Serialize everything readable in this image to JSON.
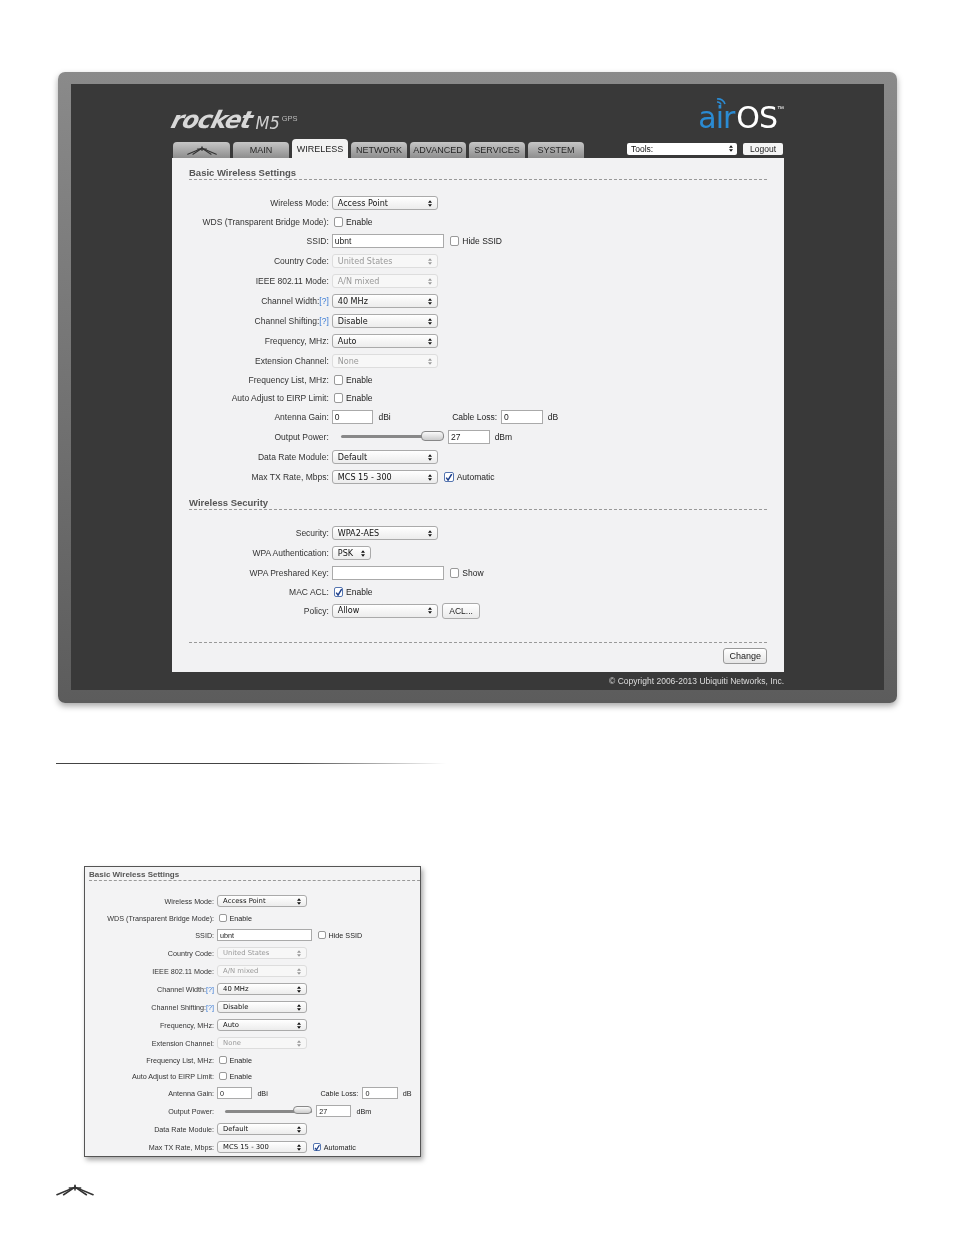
{
  "screenshot": {
    "brand": {
      "product": "rocket",
      "model": "M5",
      "suffix": "GPS",
      "os_prefix": "air",
      "os": "OS",
      "trademark": "™"
    },
    "tabs": [
      {
        "kind": "logo",
        "selected": false
      },
      {
        "kind": "text",
        "label": "MAIN",
        "selected": false
      },
      {
        "kind": "text",
        "label": "WIRELESS",
        "selected": true
      },
      {
        "kind": "text",
        "label": "NETWORK",
        "selected": false
      },
      {
        "kind": "text",
        "label": "ADVANCED",
        "selected": false
      },
      {
        "kind": "text",
        "label": "SERVICES",
        "selected": false
      },
      {
        "kind": "text",
        "label": "SYSTEM",
        "selected": false
      }
    ],
    "tools": {
      "value": "Tools:"
    },
    "logout": "Logout",
    "sections": [
      {
        "title": "Basic Wireless Settings",
        "rows": [
          {
            "kind": "select",
            "label": "Wireless Mode:",
            "value": "Access Point",
            "disabled": false
          },
          {
            "kind": "checkbox",
            "label": "WDS (Transparent Bridge Mode):",
            "checked": false,
            "text": "Enable"
          },
          {
            "kind": "input",
            "label": "SSID:",
            "value": "ubnt",
            "option": {
              "checked": false,
              "text": "Hide SSID"
            }
          },
          {
            "kind": "select",
            "label": "Country Code:",
            "value": "United States",
            "disabled": true
          },
          {
            "kind": "select",
            "label": "IEEE 802.11 Mode:",
            "value": "A/N mixed",
            "disabled": true
          },
          {
            "kind": "select",
            "label": "Channel Width:",
            "help": "[?]",
            "value": "40 MHz",
            "disabled": false
          },
          {
            "kind": "select",
            "label": "Channel Shifting:",
            "help": "[?]",
            "value": "Disable",
            "disabled": false
          },
          {
            "kind": "select",
            "label": "Frequency, MHz:",
            "value": "Auto",
            "disabled": false
          },
          {
            "kind": "select",
            "label": "Extension Channel:",
            "value": "None",
            "disabled": true
          },
          {
            "kind": "checkbox",
            "label": "Frequency List, MHz:",
            "checked": false,
            "text": "Enable"
          },
          {
            "kind": "checkbox",
            "label": "Auto Adjust to EIRP Limit:",
            "checked": false,
            "text": "Enable"
          },
          {
            "kind": "pair",
            "label": "Antenna Gain:",
            "value": "0",
            "unit": "dBi",
            "label2": "Cable Loss:",
            "value2": "0",
            "unit2": "dB"
          },
          {
            "kind": "slider",
            "label": "Output Power:",
            "level": 1,
            "value": "27",
            "unit": "dBm"
          },
          {
            "kind": "select",
            "label": "Data Rate Module:",
            "value": "Default",
            "disabled": false
          },
          {
            "kind": "select",
            "label": "Max TX Rate, Mbps:",
            "value": "MCS 15 - 300",
            "disabled": false,
            "option": {
              "checked": true,
              "text": "Automatic"
            }
          }
        ]
      },
      {
        "title": "Wireless Security",
        "rows": [
          {
            "kind": "select",
            "label": "Security:",
            "value": "WPA2-AES",
            "disabled": false
          },
          {
            "kind": "short_select",
            "label": "WPA Authentication:",
            "value": "PSK",
            "disabled": false
          },
          {
            "kind": "input",
            "label": "WPA Preshared Key:",
            "option": {
              "checked": false,
              "text": "Show"
            }
          },
          {
            "kind": "checkbox",
            "label": "MAC ACL:",
            "checked": true,
            "text": "Enable"
          },
          {
            "kind": "select",
            "label": "Policy:",
            "value": "Allow",
            "disabled": false,
            "button": "ACL..."
          }
        ]
      }
    ],
    "change_button": "Change",
    "copyright": "© Copyright 2006-2013 Ubiquiti Networks, Inc."
  },
  "detail_screenshot": {
    "section": {
      "title": "Basic Wireless Settings",
      "rows": [
        {
          "kind": "select",
          "label": "Wireless Mode:",
          "value": "Access Point",
          "disabled": false
        },
        {
          "kind": "checkbox",
          "label": "WDS (Transparent Bridge Mode):",
          "checked": false,
          "text": "Enable"
        },
        {
          "kind": "input",
          "label": "SSID:",
          "value": "ubnt",
          "option": {
            "checked": false,
            "text": "Hide SSID"
          }
        },
        {
          "kind": "select",
          "label": "Country Code:",
          "value": "United States",
          "disabled": true
        },
        {
          "kind": "select",
          "label": "IEEE 802.11 Mode:",
          "value": "A/N mixed",
          "disabled": true
        },
        {
          "kind": "select",
          "label": "Channel Width:",
          "help": "[?]",
          "value": "40 MHz",
          "disabled": false
        },
        {
          "kind": "select",
          "label": "Channel Shifting:",
          "help": "[?]",
          "value": "Disable",
          "disabled": false
        },
        {
          "kind": "select",
          "label": "Frequency, MHz:",
          "value": "Auto",
          "disabled": false
        },
        {
          "kind": "select",
          "label": "Extension Channel:",
          "value": "None",
          "disabled": true
        },
        {
          "kind": "checkbox",
          "label": "Frequency List, MHz:",
          "checked": false,
          "text": "Enable"
        },
        {
          "kind": "checkbox",
          "label": "Auto Adjust to EIRP Limit:",
          "checked": false,
          "text": "Enable"
        },
        {
          "kind": "pair",
          "label": "Antenna Gain:",
          "value": "0",
          "unit": "dBi",
          "label2": "Cable Loss:",
          "value2": "0",
          "unit2": "dB"
        },
        {
          "kind": "slider",
          "label": "Output Power:",
          "level": 1,
          "value": "27",
          "unit": "dBm"
        },
        {
          "kind": "select",
          "label": "Data Rate Module:",
          "value": "Default",
          "disabled": false
        },
        {
          "kind": "select",
          "label": "Max TX Rate, Mbps:",
          "value": "MCS 15 - 300",
          "disabled": false,
          "option": {
            "checked": true,
            "text": "Automatic"
          }
        }
      ]
    }
  }
}
